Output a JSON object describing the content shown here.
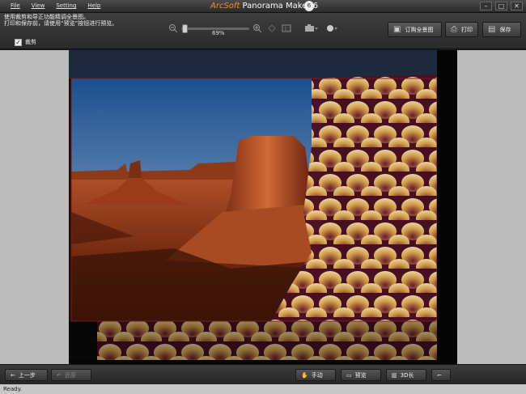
{
  "menu": [
    "File",
    "View",
    "Setting",
    "Help"
  ],
  "title": {
    "brand": "ArcSoft",
    "name": " Panorama Maker 6",
    "badge": "6"
  },
  "window_buttons": [
    "–",
    "□",
    "✕"
  ],
  "instructions": [
    "使用裁剪和导正功能精调全景图。",
    "打印和保存前，请使用“预览”按钮进行预览。"
  ],
  "crop": {
    "checked": "✓",
    "label": "裁剪"
  },
  "zoom": {
    "value_text": "69%",
    "value": 0.69
  },
  "toolbar_buttons": {
    "order": "订购全景图",
    "print": "打印",
    "save": "保存"
  },
  "bottom_buttons": {
    "back": "上一步",
    "undo": "还原",
    "hand": "手动",
    "preview": "预览",
    "view3d": "3D长"
  },
  "status": "Ready."
}
